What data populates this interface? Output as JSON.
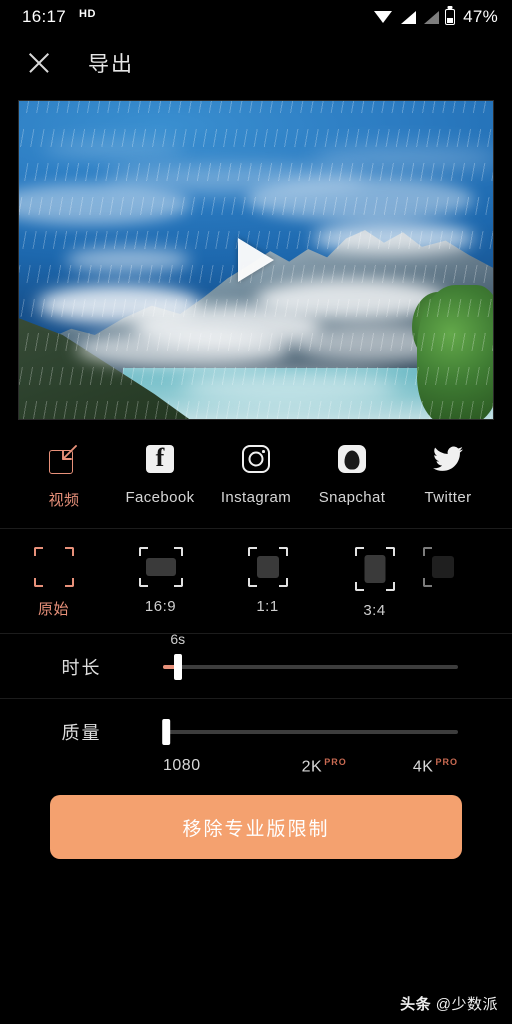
{
  "status_bar": {
    "time": "16:17",
    "hd_badge": "HD",
    "battery_percent": "47%",
    "icons": [
      "wifi-icon",
      "signal-icon",
      "signal-icon-secondary",
      "battery-icon"
    ]
  },
  "top_bar": {
    "close_icon": "close-icon",
    "title": "导出"
  },
  "preview": {
    "play_icon": "play-icon",
    "description": "雪山云海视频预览"
  },
  "share": {
    "items": [
      {
        "label": "视频",
        "icon": "save-video-icon",
        "active": true
      },
      {
        "label": "Facebook",
        "icon": "facebook-icon",
        "active": false
      },
      {
        "label": "Instagram",
        "icon": "instagram-icon",
        "active": false
      },
      {
        "label": "Snapchat",
        "icon": "snapchat-icon",
        "active": false
      },
      {
        "label": "Twitter",
        "icon": "twitter-icon",
        "active": false
      }
    ]
  },
  "ratio": {
    "items": [
      {
        "label": "原始",
        "active": true
      },
      {
        "label": "16:9",
        "active": false
      },
      {
        "label": "1:1",
        "active": false
      },
      {
        "label": "3:4",
        "active": false
      },
      {
        "label": "",
        "active": false
      }
    ]
  },
  "duration": {
    "label": "时长",
    "value": "6s",
    "thumb_percent": 5,
    "fill_percent": 5
  },
  "quality": {
    "label": "质量",
    "thumb_percent": 0,
    "ticks": [
      {
        "text": "1080",
        "pro": ""
      },
      {
        "text": "2K",
        "pro": "PRO"
      },
      {
        "text": "4K",
        "pro": "PRO"
      }
    ]
  },
  "cta": {
    "label": "移除专业版限制"
  },
  "watermark": {
    "brand": "头条",
    "handle": " @少数派"
  },
  "colors": {
    "accent": "#e8917a",
    "cta_bg": "#f4a16f",
    "background": "#000000",
    "pro_tag": "#c96a52"
  }
}
